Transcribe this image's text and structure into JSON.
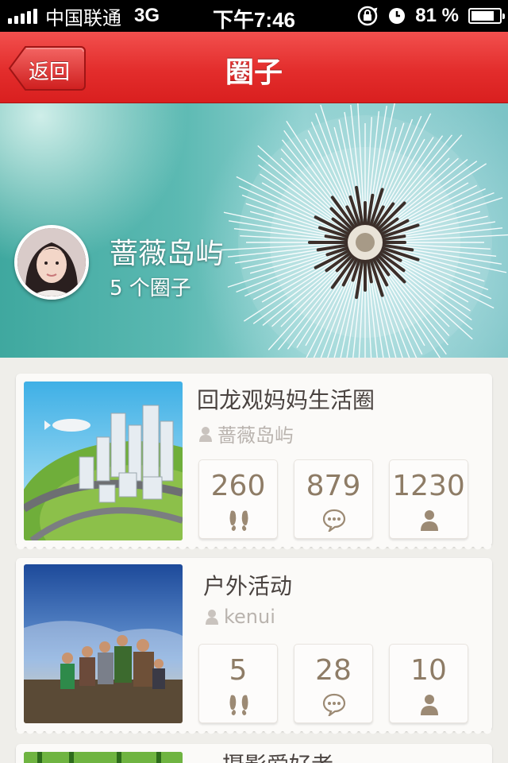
{
  "status_bar": {
    "carrier": "中国联通",
    "network": "3G",
    "time": "下午7:46",
    "battery_percent": "81 %",
    "battery_level": 0.81
  },
  "nav": {
    "back_label": "返回",
    "title": "圈子"
  },
  "profile": {
    "name": "蔷薇岛屿",
    "circle_count": "5 个圈子"
  },
  "circles": [
    {
      "title": "回龙观妈妈生活圈",
      "owner": "蔷薇岛屿",
      "stats": {
        "footprints": "260",
        "comments": "879",
        "members": "1230"
      }
    },
    {
      "title": "户外活动",
      "owner": "kenui",
      "stats": {
        "footprints": "5",
        "comments": "28",
        "members": "10"
      }
    },
    {
      "title": "摄影爱好者"
    }
  ],
  "icons": {
    "footprints": "footprints-icon",
    "comments": "speech-bubble-icon",
    "members": "person-icon",
    "owner": "person-icon"
  },
  "colors": {
    "nav_red": "#e32d2c",
    "stat_text": "#8e7c66",
    "background": "#efeeea"
  }
}
